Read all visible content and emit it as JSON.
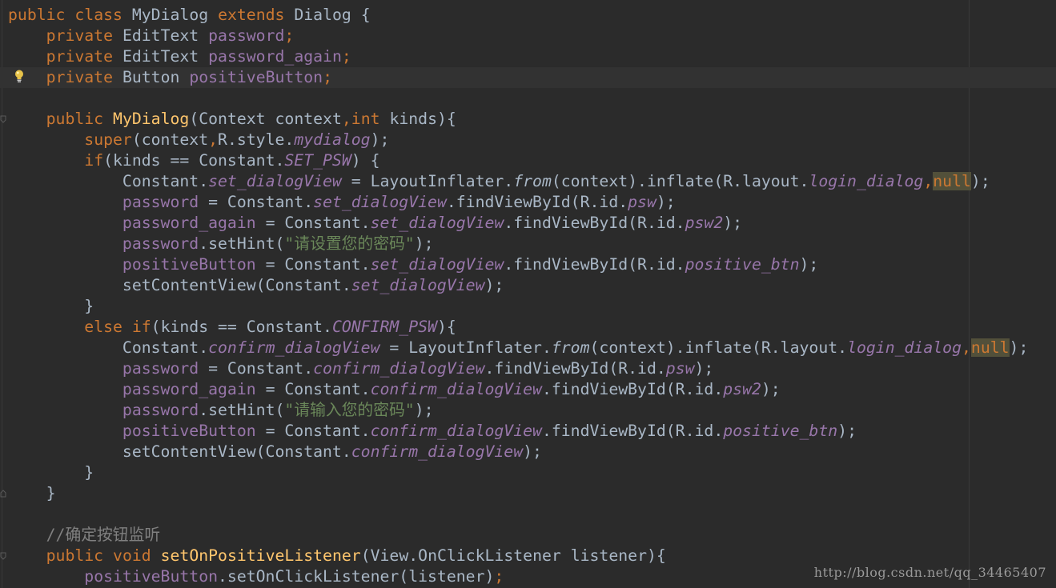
{
  "watermark": "http://blog.csdn.net/qq_34465407",
  "code": {
    "l1": [
      "public",
      "class",
      "MyDialog",
      "extends",
      "Dialog {"
    ],
    "l2": [
      "private",
      "EditText",
      "password",
      ";"
    ],
    "l3": [
      "private",
      "EditText",
      "password_again",
      ";"
    ],
    "l4": [
      "private",
      "Button",
      "positiveButton",
      ";"
    ],
    "l6": [
      "public",
      "MyDialog",
      "(Context context",
      ",",
      "int",
      " kinds){"
    ],
    "l7": [
      "super",
      "(context",
      ",",
      "R.style.",
      "mydialog",
      ");"
    ],
    "l8": [
      "if",
      "(kinds == Constant.",
      "SET_PSW",
      ") {"
    ],
    "l9": [
      "Constant.",
      "set_dialogView",
      " = LayoutInflater.",
      "from",
      "(context).inflate(R.layout.",
      "login_dialog",
      ",",
      "null",
      ");"
    ],
    "l10": [
      "password",
      " = Constant.",
      "set_dialogView",
      ".findViewById(R.id.",
      "psw",
      ");"
    ],
    "l11": [
      "password_again",
      " = Constant.",
      "set_dialogView",
      ".findViewById(R.id.",
      "psw2",
      ");"
    ],
    "l12": [
      "password",
      ".setHint(",
      "\"请设置您的密码\"",
      ");"
    ],
    "l13": [
      "positiveButton",
      " = Constant.",
      "set_dialogView",
      ".findViewById(R.id.",
      "positive_btn",
      ");"
    ],
    "l14": [
      "setContentView(Constant.",
      "set_dialogView",
      ");"
    ],
    "l15": [
      "}"
    ],
    "l16": [
      "else if",
      "(kinds == Constant.",
      "CONFIRM_PSW",
      "){"
    ],
    "l17": [
      "Constant.",
      "confirm_dialogView",
      " = LayoutInflater.",
      "from",
      "(context).inflate(R.layout.",
      "login_dialog",
      ",",
      "null",
      ");"
    ],
    "l18": [
      "password",
      " = Constant.",
      "confirm_dialogView",
      ".findViewById(R.id.",
      "psw",
      ");"
    ],
    "l19": [
      "password_again",
      " = Constant.",
      "confirm_dialogView",
      ".findViewById(R.id.",
      "psw2",
      ");"
    ],
    "l20": [
      "password",
      ".setHint(",
      "\"请输入您的密码\"",
      ");"
    ],
    "l21": [
      "positiveButton",
      " = Constant.",
      "confirm_dialogView",
      ".findViewById(R.id.",
      "positive_btn",
      ");"
    ],
    "l22": [
      "setContentView(Constant.",
      "confirm_dialogView",
      ");"
    ],
    "l23": [
      "}"
    ],
    "l24": [
      "}"
    ],
    "l26": [
      "//确定按钮监听"
    ],
    "l27": [
      "public",
      "void",
      "setOnPositiveListener",
      "(View.OnClickListener listener){"
    ],
    "l28": [
      "positiveButton",
      ".setOnClickListener(listener)",
      ";"
    ]
  },
  "icons": {
    "bulb": "lightbulb-icon",
    "fold": "fold-marker-icon"
  },
  "colors": {
    "background": "#2b2b2b",
    "keyword": "#cc7832",
    "method": "#ffc66d",
    "field": "#9876aa",
    "string": "#6a8759",
    "comment": "#808080",
    "text": "#a9b7c6"
  }
}
